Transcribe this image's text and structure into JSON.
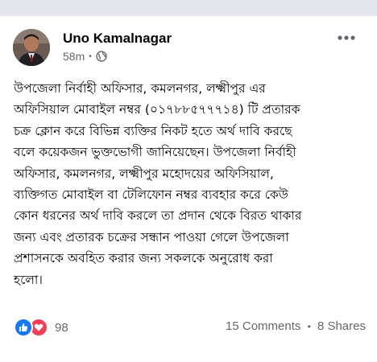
{
  "post": {
    "author": "Uno Kamalnagar",
    "time": "58m",
    "separator": "•",
    "privacy_icon": "globe-icon",
    "lines": [
      "উপজেলা নির্বাহী অফিসার, কমলনগর, লক্ষ্মীপুর এর",
      "অফিসিয়াল মোবাইল নম্বর (০১৭৮৮৫৭৭৭১৪) টি প্রতারক",
      "চক্র ক্লোন করে বিভিন্ন ব্যক্তির নিকট হতে অর্থ দাবি করছে",
      "বলে কয়েকজন ভুক্তভোগী জানিয়েছেন। উপজেলা নির্বাহী",
      "অফিসার, কমলনগর, লক্ষ্মীপুর মহোদয়ের অফিসিয়াল,",
      "ব্যক্তিগত মোবাইল বা টেলিফোন নম্বর ব্যবহার করে কেউ",
      "কোন ধরনের অর্থ দাবি করলে তা প্রদান থেকে বিরত থাকার",
      "জন্য এবং প্রতারক চক্রের সন্ধান পাওয়া গেলে উপজেলা",
      "প্রশাসনকে অবহিত করার জন্য সকলকে অনুরোধ করা",
      "হলো।"
    ]
  },
  "reactions": {
    "icons": [
      "like-icon",
      "love-icon"
    ],
    "count": "98"
  },
  "stats": {
    "comments": "15 Comments",
    "dot": "•",
    "shares": "8 Shares"
  },
  "colors": {
    "like": "#1877f2",
    "love": "#f33e58",
    "meta_text": "#65676b",
    "top_bar": "#e4e6eb"
  }
}
